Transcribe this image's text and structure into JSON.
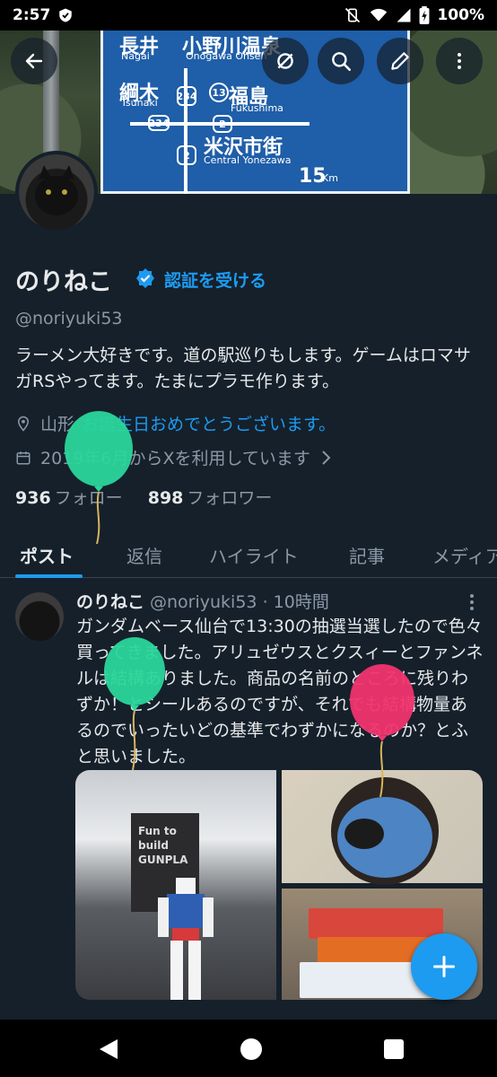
{
  "status_bar": {
    "time": "2:57",
    "battery": "100%"
  },
  "profile": {
    "name": "のりねこ",
    "verify_link": "認証を受ける",
    "handle": "@noriyuki53",
    "bio": "ラーメン大好きです。道の駅巡りもします。ゲームはロマサガRSやってます。たまにプラモ作ります。",
    "location": "山形",
    "birthday_text": "お誕生日おめでとうございます。",
    "joined": "2019年6月からXを利用しています",
    "following_count": "936",
    "following_label": "フォロー",
    "followers_count": "898",
    "followers_label": "フォロワー"
  },
  "banner_sign": {
    "nagai_jp": "長井",
    "nagai_en": "Nagai",
    "onogawa_jp": "小野川温泉",
    "onogawa_en": "Onogawa Onsen",
    "tsunaki_jp": "綱木",
    "tsunaki_en": "Tsunaki",
    "fukushima_jp": "福島",
    "fukushima_en": "Fukushima",
    "yonezawa_jp": "米沢市街",
    "yonezawa_en": "Central Yonezawa",
    "distance": "15",
    "distance_unit": "Km",
    "route_234": "234",
    "route_13": "13",
    "route_2": "2"
  },
  "tabs": [
    {
      "label": "ポスト",
      "active": true
    },
    {
      "label": "返信",
      "active": false
    },
    {
      "label": "ハイライト",
      "active": false
    },
    {
      "label": "記事",
      "active": false
    },
    {
      "label": "メディア",
      "active": false
    }
  ],
  "post": {
    "author": "のりねこ",
    "handle": "@noriyuki53",
    "separator": "·",
    "time": "10時間",
    "text": "ガンダムベース仙台で13:30の抽選当選したので色々買ってきました。アリュゼウスとクスィーとファンネルは結構ありました。商品の名前のところに残りわずか！とシールあるのですが、それでも結構物量あるのでいったいどの基準でわずかになるのか？とふと思いました。",
    "media_sign_text": "Fun to build GUNPLA"
  },
  "colors": {
    "background": "#15202b",
    "accent": "#1d9bf0",
    "text": "#e7e9ea",
    "muted": "#8b98a5",
    "balloon_green": "#2ad69a",
    "balloon_pink": "#f0346e"
  },
  "icons": [
    "back-arrow-icon",
    "no-retweet-icon",
    "search-icon",
    "edit-icon",
    "more-vertical-icon",
    "verified-badge-icon",
    "location-pin-icon",
    "calendar-icon",
    "chevron-right-icon",
    "plus-icon",
    "nav-back-icon",
    "nav-home-icon",
    "nav-recents-icon"
  ]
}
